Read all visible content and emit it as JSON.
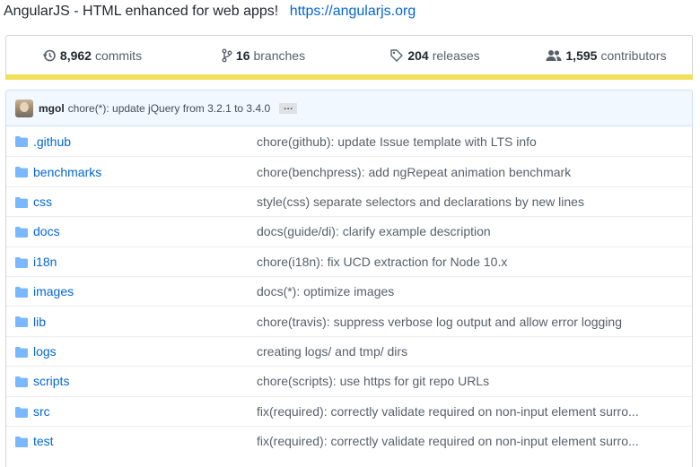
{
  "repo": {
    "description": "AngularJS - HTML enhanced for web apps!",
    "homepage": "https://angularjs.org"
  },
  "summary": {
    "commits": {
      "count": "8,962",
      "label": "commits",
      "icon": "history-icon"
    },
    "branches": {
      "count": "16",
      "label": "branches",
      "icon": "branch-icon"
    },
    "releases": {
      "count": "204",
      "label": "releases",
      "icon": "tag-icon"
    },
    "contributors": {
      "count": "1,595",
      "label": "contributors",
      "icon": "people-icon"
    },
    "language_color": "#f1e05a"
  },
  "latest_commit": {
    "author": "mgol",
    "message": "chore(*): update jQuery from 3.2.1 to 3.4.0",
    "expand_label": "…"
  },
  "files": [
    {
      "name": ".github",
      "message": "chore(github): update Issue template with LTS info"
    },
    {
      "name": "benchmarks",
      "message": "chore(benchpress): add ngRepeat animation benchmark"
    },
    {
      "name": "css",
      "message": "style(css) separate selectors and declarations by new lines"
    },
    {
      "name": "docs",
      "message": "docs(guide/di): clarify example description"
    },
    {
      "name": "i18n",
      "message": "chore(i18n): fix UCD extraction for Node 10.x"
    },
    {
      "name": "images",
      "message": "docs(*): optimize images"
    },
    {
      "name": "lib",
      "message": "chore(travis): suppress verbose log output and allow error logging"
    },
    {
      "name": "logs",
      "message": "creating logs/ and tmp/ dirs"
    },
    {
      "name": "scripts",
      "message": "chore(scripts): use https for git repo URLs"
    },
    {
      "name": "src",
      "message": "fix(required): correctly validate required on non-input element surro..."
    },
    {
      "name": "test",
      "message": "fix(required): correctly validate required on non-input element surro..."
    }
  ],
  "colors": {
    "link": "#0366d6",
    "folder": "#79b8ff",
    "commit_bg": "#f1f8ff"
  }
}
